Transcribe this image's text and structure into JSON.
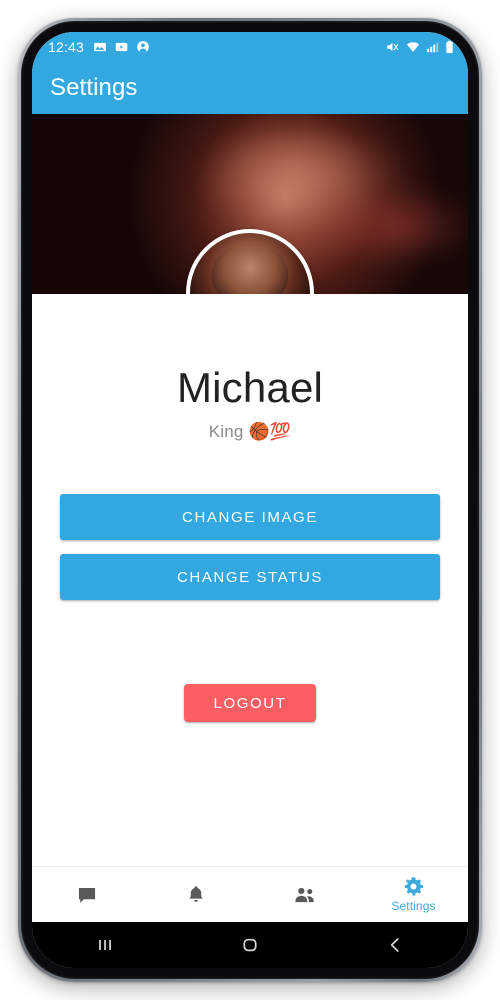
{
  "status_bar": {
    "time": "12:43",
    "left_icons": [
      "image-icon",
      "video-icon",
      "account-icon"
    ],
    "right_icons": [
      "mute-icon",
      "wifi-icon",
      "signal-icon",
      "battery-icon"
    ]
  },
  "app_bar": {
    "title": "Settings"
  },
  "profile": {
    "cover_photo_alt": "cover-photo",
    "avatar_alt": "profile-avatar",
    "name": "Michael",
    "status": "King 🏀💯"
  },
  "actions": {
    "change_image_label": "CHANGE IMAGE",
    "change_status_label": "CHANGE STATUS",
    "logout_label": "LOGOUT"
  },
  "bottom_nav": {
    "items": [
      {
        "name": "chat",
        "icon": "chat-bubble-icon",
        "label": "",
        "active": false
      },
      {
        "name": "notifications",
        "icon": "bell-icon",
        "label": "",
        "active": false
      },
      {
        "name": "friends",
        "icon": "people-icon",
        "label": "",
        "active": false
      },
      {
        "name": "settings",
        "icon": "gear-icon",
        "label": "Settings",
        "active": true
      }
    ]
  },
  "android_nav": {
    "recents": "recents-icon",
    "home": "home-icon",
    "back": "back-icon"
  },
  "colors": {
    "accent_blue": "#33a7e0",
    "logout_red": "#fb5f63",
    "nav_inactive": "#5a5a5a",
    "nav_active": "#3fa9dc",
    "name_text": "#222222",
    "status_text": "#8b8b8b"
  }
}
